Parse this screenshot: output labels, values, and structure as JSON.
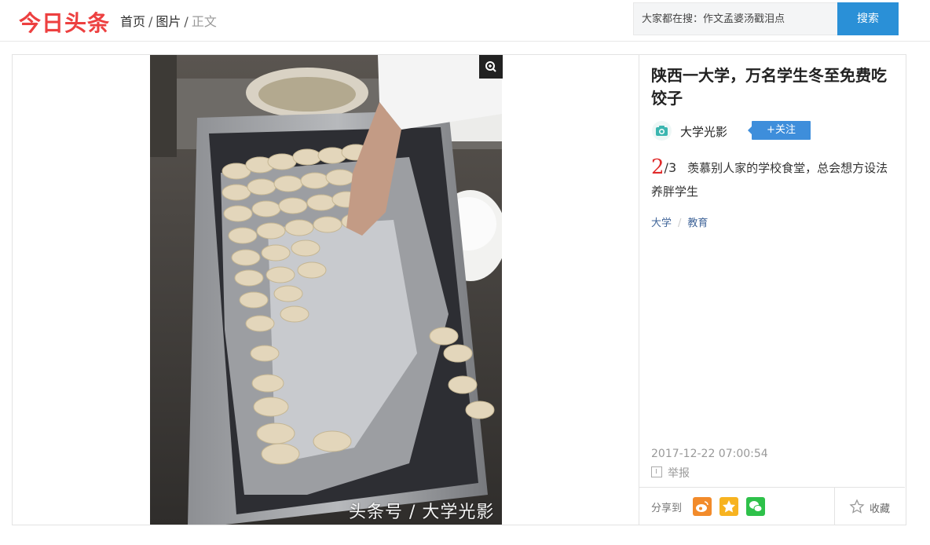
{
  "header": {
    "logo": "今日头条",
    "breadcrumb": {
      "home": "首页",
      "images": "图片",
      "current": "正文",
      "separator": "/"
    },
    "search": {
      "placeholder": "大家都在搜：作文孟婆汤戳泪点",
      "button": "搜索"
    }
  },
  "photo": {
    "watermark": "头条号 / 大学光影",
    "zoom_icon": "zoom-in-icon"
  },
  "article": {
    "title": "陕西一大学，万名学生冬至免费吃饺子",
    "author": {
      "name": "大学光影",
      "follow_label": "+关注"
    },
    "page_current": "2",
    "page_total": "/3",
    "caption": "羡慕别人家的学校食堂，总会想方设法养胖学生",
    "tags": [
      "大学",
      "教育"
    ],
    "tag_separator": "/",
    "timestamp": "2017-12-22 07:00:54",
    "report_label": "举报",
    "share_label": "分享到",
    "favorite_label": "收藏"
  },
  "colors": {
    "brand_red": "#ed4040",
    "search_blue": "#2a90d7",
    "follow_blue": "#3e8edb",
    "page_red": "#e02a2a",
    "tag_blue": "#406599"
  }
}
